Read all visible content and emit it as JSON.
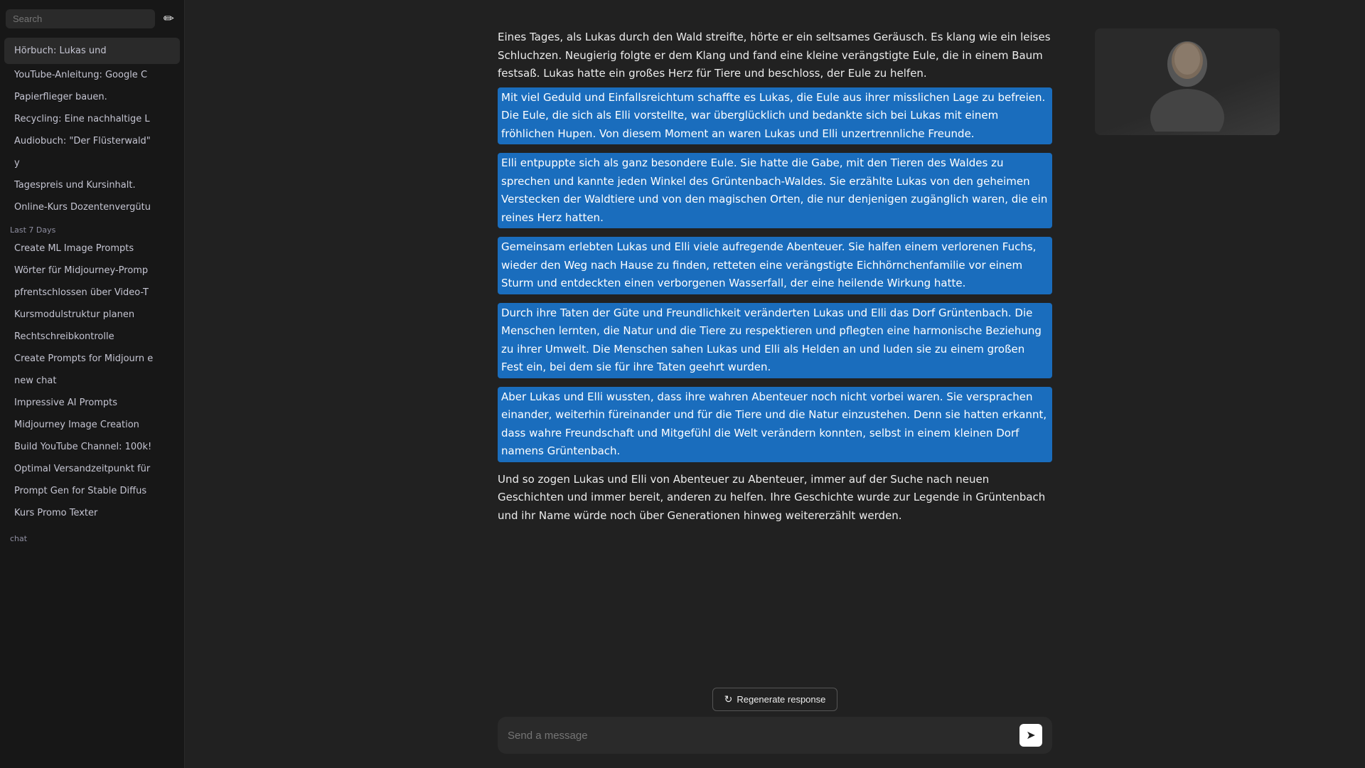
{
  "sidebar": {
    "search_placeholder": "Search",
    "new_chat_icon": "✏",
    "sections": [
      {
        "label": "",
        "items": [
          {
            "id": "audiobuch-lukas",
            "text": "Hörbuch: Lukas und",
            "has_icons": true
          },
          {
            "id": "youtube-anleitung",
            "text": "YouTube-Anleitung: Google C"
          },
          {
            "id": "papierflieger",
            "text": "Papierflieger bauen."
          },
          {
            "id": "recycling",
            "text": "Recycling: Eine nachhaltige L"
          },
          {
            "id": "audiobuch-fluster",
            "text": "Audiobuch: \"Der Flüsterwald\""
          }
        ]
      },
      {
        "label": "",
        "items": [
          {
            "id": "y",
            "text": "y"
          },
          {
            "id": "tagespreis",
            "text": "Tagespreis und Kursinhalt."
          },
          {
            "id": "online-kurs",
            "text": "Online-Kurs Dozentenvergütu"
          }
        ]
      },
      {
        "label": "Last 7 Days",
        "items": [
          {
            "id": "create-ml",
            "text": "Create ML Image Prompts"
          },
          {
            "id": "worter-midjourney",
            "text": "Wörter für Midjourney-Promp"
          },
          {
            "id": "pfrentschlossen",
            "text": "pfrentschlossen über Video-T"
          },
          {
            "id": "kursmodulstruktur",
            "text": "Kursmodulstruktur planen"
          },
          {
            "id": "rechtschreibkontrolle",
            "text": "Rechtschreibkontrolle"
          },
          {
            "id": "create-prompts-midjourney",
            "text": "Create Prompts for Midjourn e"
          },
          {
            "id": "new-chat",
            "text": "new chat"
          },
          {
            "id": "impressive-ai",
            "text": "Impressive AI Prompts"
          },
          {
            "id": "midjourney-image",
            "text": "Midjourney Image Creation"
          },
          {
            "id": "build-youtube",
            "text": "Build YouTube Channel: 100k!"
          },
          {
            "id": "optimal-versand",
            "text": "Optimal Versandzeitpunkt für"
          },
          {
            "id": "prompt-gen-stable",
            "text": "Prompt Gen for Stable Diffus"
          },
          {
            "id": "kurs-promo",
            "text": "Kurs Promo Texter"
          }
        ]
      }
    ],
    "bottom_label": "chat"
  },
  "chat": {
    "paragraphs": [
      {
        "id": "p1",
        "highlighted": false,
        "text": "Eines Tages, als Lukas durch den Wald streifte, hörte er ein seltsames Geräusch. Es klang wie ein leises Schluchzen. Neugierig folgte er dem Klang und fand eine kleine verängstigte Eule, die in einem Baum festsaß. Lukas hatte ein großes Herz für Tiere und beschloss, der Eule zu helfen."
      },
      {
        "id": "p2",
        "highlighted": true,
        "text": "Mit viel Geduld und Einfallsreichtum schaffte es Lukas, die Eule aus ihrer misslichen Lage zu befreien. Die Eule, die sich als Elli vorstellte, war überglücklich und bedankte sich bei Lukas mit einem fröhlichen Hupen. Von diesem Moment an waren Lukas und Elli unzertrennliche Freunde."
      },
      {
        "id": "p3",
        "highlighted": true,
        "text": "Elli entpuppte sich als ganz besondere Eule. Sie hatte die Gabe, mit den Tieren des Waldes zu sprechen und kannte jeden Winkel des Grüntenbach-Waldes. Sie erzählte Lukas von den geheimen Verstecken der Waldtiere und von den magischen Orten, die nur denjenigen zugänglich waren, die ein reines Herz hatten."
      },
      {
        "id": "p4",
        "highlighted": true,
        "text": "Gemeinsam erlebten Lukas und Elli viele aufregende Abenteuer. Sie halfen einem verlorenen Fuchs, wieder den Weg nach Hause zu finden, retteten eine verängstigte Eichhörnchenfamilie vor einem Sturm und entdeckten einen verborgenen Wasserfall, der eine heilende Wirkung hatte."
      },
      {
        "id": "p5",
        "highlighted": true,
        "text": "Durch ihre Taten der Güte und Freundlichkeit veränderten Lukas und Elli das Dorf Grüntenbach. Die Menschen lernten, die Natur und die Tiere zu respektieren und pflegten eine harmonische Beziehung zu ihrer Umwelt. Die Menschen sahen Lukas und Elli als Helden an und luden sie zu einem großen Fest ein, bei dem sie für ihre Taten geehrt wurden."
      },
      {
        "id": "p6",
        "highlighted": true,
        "text": "Aber Lukas und Elli wussten, dass ihre wahren Abenteuer noch nicht vorbei waren. Sie versprachen einander, weiterhin füreinander und für die Tiere und die Natur einzustehen. Denn sie hatten erkannt, dass wahre Freundschaft und Mitgefühl die Welt verändern konnten, selbst in einem kleinen Dorf namens Grüntenbach."
      },
      {
        "id": "p7",
        "highlighted": false,
        "text": "Und so zogen Lukas und Elli von Abenteuer zu Abenteuer, immer auf der Suche nach neuen Geschichten und immer bereit, anderen zu helfen. Ihre Geschichte wurde zur Legende in Grüntenbach und ihr Name würde noch über Generationen hinweg weitererzählt werden."
      }
    ],
    "regenerate_label": "Regenerate response",
    "send_placeholder": "Send a message",
    "send_icon": "➤"
  }
}
